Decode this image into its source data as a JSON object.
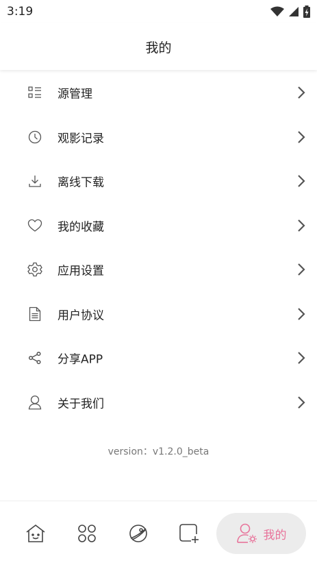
{
  "status_bar": {
    "time": "3:19",
    "icons": [
      "wifi-icon",
      "cell-signal-icon",
      "battery-charging-icon"
    ]
  },
  "app_bar": {
    "title": "我的"
  },
  "menu": {
    "items": [
      {
        "label": "源管理",
        "icon": "list-icon"
      },
      {
        "label": "观影记录",
        "icon": "clock-icon"
      },
      {
        "label": "离线下载",
        "icon": "download-icon"
      },
      {
        "label": "我的收藏",
        "icon": "heart-icon"
      },
      {
        "label": "应用设置",
        "icon": "gear-icon"
      },
      {
        "label": "用户协议",
        "icon": "document-icon"
      },
      {
        "label": "分享APP",
        "icon": "share-icon"
      },
      {
        "label": "关于我们",
        "icon": "person-icon"
      }
    ]
  },
  "version_text": "version：v1.2.0_beta",
  "bottom_nav": {
    "items": [
      {
        "icon": "home-icon"
      },
      {
        "icon": "grid-icon"
      },
      {
        "icon": "planet-icon"
      },
      {
        "icon": "add-square-icon"
      }
    ],
    "active": {
      "label": "我的",
      "icon": "user-settings-icon"
    }
  },
  "colors": {
    "accent": "#e8739a",
    "active_bg": "#ececec"
  }
}
